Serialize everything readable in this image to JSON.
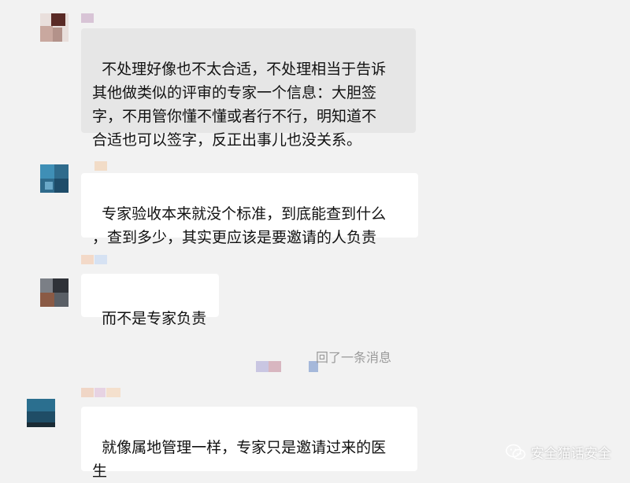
{
  "messages": [
    {
      "text": "不处理好像也不太合适，不处理相当于告诉\n其他做类似的评审的专家一个信息：大胆签\n字，不用管你懂不懂或者行不行，明知道不\n合适也可以签字，反正出事儿也没关系。"
    },
    {
      "text": "专家验收本来就没个标准，到底能查到什么\n，查到多少，其实更应该是要邀请的人负责"
    },
    {
      "text": "而不是专家负责"
    },
    {
      "text": "就像属地管理一样，专家只是邀请过来的医\n生"
    }
  ],
  "recall_notice": "回了一条消息",
  "watermark": {
    "account": "安全猫话安全",
    "icon": "wechat-icon"
  },
  "colors": {
    "background": "#f2f2f2",
    "bubble": "#ffffff",
    "bubble_highlight": "#e6e6e6",
    "text": "#111111",
    "muted": "#9a9a9a"
  }
}
